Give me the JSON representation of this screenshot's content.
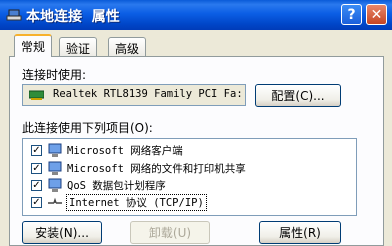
{
  "window": {
    "title": "本地连接  属性",
    "help_button": "?",
    "close_button": "✕"
  },
  "tabs": [
    {
      "label": "常规"
    },
    {
      "label": "验证"
    },
    {
      "label": "高级"
    }
  ],
  "general": {
    "connect_using_label": "连接时使用:",
    "adapter_name": "Realtek RTL8139 Family PCI Fa:",
    "configure_button": "配置(C)...",
    "items_label": "此连接使用下列项目(O):",
    "items": [
      {
        "label": "Microsoft 网络客户端",
        "checked": true
      },
      {
        "label": "Microsoft 网络的文件和打印机共享",
        "checked": true
      },
      {
        "label": "QoS 数据包计划程序",
        "checked": true
      },
      {
        "label": "Internet 协议 (TCP/IP)",
        "checked": true
      }
    ],
    "install_button": "安装(N)...",
    "uninstall_button": "卸载(U)",
    "properties_button": "属性(R)"
  },
  "colors": {
    "titlebar": "#0a5bd8",
    "active_tab_accent": "#f7b12d",
    "dialog_bg": "#ece9d8"
  }
}
